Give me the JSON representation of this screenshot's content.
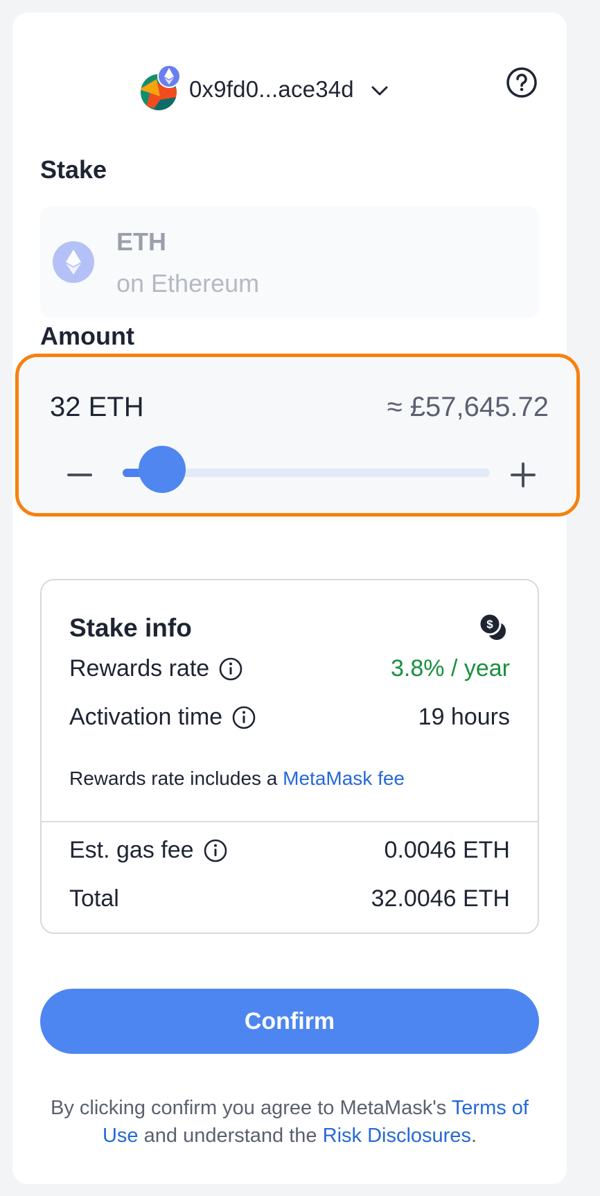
{
  "header": {
    "account_name": "0x9fd0...ace34d"
  },
  "stake": {
    "label": "Stake",
    "token": "ETH",
    "network": "on Ethereum"
  },
  "amount": {
    "label": "Amount",
    "value": "32 ETH",
    "fiat": "≈ £57,645.72",
    "slider_fraction": 0.05
  },
  "stake_info": {
    "title": "Stake info",
    "rewards_rate_label": "Rewards rate",
    "rewards_rate_value": "3.8% / year",
    "activation_label": "Activation time",
    "activation_value": "19 hours",
    "note_text": "Rewards rate includes a",
    "note_link": "MetaMask fee",
    "gas_label": "Est. gas fee",
    "gas_value": "0.0046 ETH",
    "total_label": "Total",
    "total_value": "32.0046 ETH"
  },
  "confirm_label": "Confirm",
  "legal": {
    "text1": "By clicking confirm you agree to MetaMask's",
    "terms_link": "Terms of Use",
    "text2": "and understand the",
    "risk_link": "Risk Disclosures",
    "end": "."
  },
  "colors": {
    "accent_blue": "#4d86f0",
    "highlight_orange": "#f6810f",
    "rewards_green": "#1a8f3e",
    "link_blue": "#2569d8"
  },
  "icons": [
    "account-avatar",
    "ethereum-badge-icon",
    "chevron-down-icon",
    "help-icon",
    "eth-token-icon",
    "minus-icon",
    "plus-icon",
    "coin-dollar-icon",
    "info-icon"
  ]
}
